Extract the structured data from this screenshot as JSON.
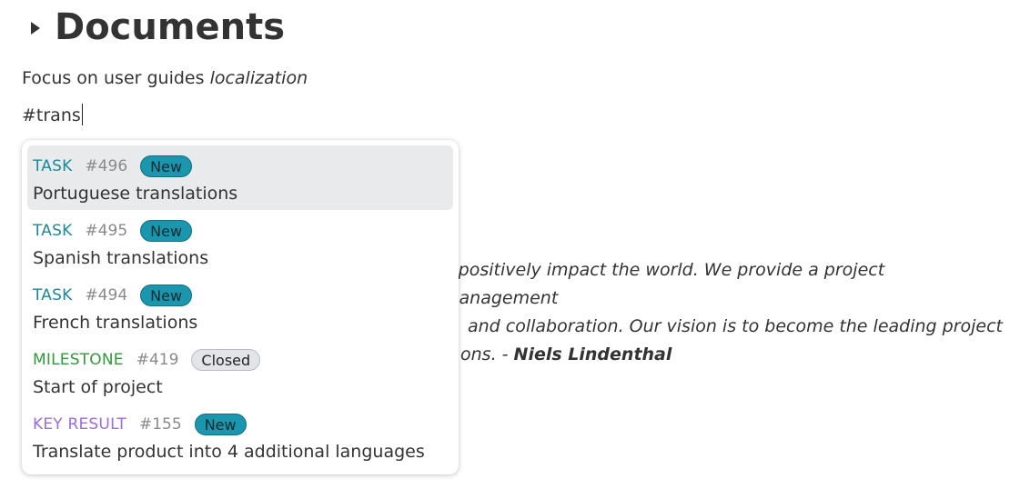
{
  "heading": {
    "title": "Documents"
  },
  "lead": {
    "text": "Focus on user guides ",
    "emphasis": "localization"
  },
  "editor": {
    "typed": "#trans"
  },
  "quote": {
    "text": "o positively impact the world. We provide a project management",
    "line2": "and collaboration. Our vision is to become the leading project",
    "line3": "ons. - ",
    "author": "Niels Lindenthal"
  },
  "colors": {
    "task": "#1a8a9a",
    "milestone": "#2f9a3a",
    "keyresult": "#9a6ce0",
    "badge_new": "#1a97ae",
    "badge_closed": "#e2e4e8",
    "selected_bg": "#e9eaec"
  },
  "suggestions": [
    {
      "type": "TASK",
      "number": "#496",
      "status": "New",
      "title": "Portuguese translations",
      "selected": true
    },
    {
      "type": "TASK",
      "number": "#495",
      "status": "New",
      "title": "Spanish translations",
      "selected": false
    },
    {
      "type": "TASK",
      "number": "#494",
      "status": "New",
      "title": "French translations",
      "selected": false
    },
    {
      "type": "MILESTONE",
      "number": "#419",
      "status": "Closed",
      "title": "Start of project",
      "selected": false
    },
    {
      "type": "KEY RESULT",
      "number": "#155",
      "status": "New",
      "title": "Translate product into 4 additional languages",
      "selected": false
    }
  ]
}
